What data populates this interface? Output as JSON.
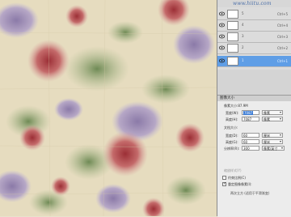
{
  "watermark": "www.hiitu.com",
  "layers": [
    {
      "name": "5",
      "shortcut": "Ctrl+5"
    },
    {
      "name": "4",
      "shortcut": "Ctrl+4"
    },
    {
      "name": "3",
      "shortcut": "Ctrl+3"
    },
    {
      "name": "2",
      "shortcut": "Ctrl+2"
    },
    {
      "name": "1",
      "shortcut": "Ctrl+1"
    }
  ],
  "dialog": {
    "title": "图像大小",
    "pixel_dims_label": "像素大小:87.9M",
    "width_label": "宽度(W):",
    "width_value": "7087",
    "height_label": "高度(H):",
    "height_value": "7087",
    "pixel_unit": "像素",
    "doc_size_label": "文档大小:",
    "doc_width_label": "宽度(D):",
    "doc_width_value": "60",
    "doc_height_label": "高度(G):",
    "doc_height_value": "60",
    "unit_cm": "厘米",
    "resolution_label": "分辨率(R):",
    "resolution_value": "300",
    "resolution_unit": "像素/英寸",
    "scale_styles_label": "缩放样式(Y)",
    "constrain_label": "约束比例(C)",
    "resample_label": "重定图像像素(I):",
    "resample_hint": "两次立方 (适用于平滑渐变)"
  }
}
